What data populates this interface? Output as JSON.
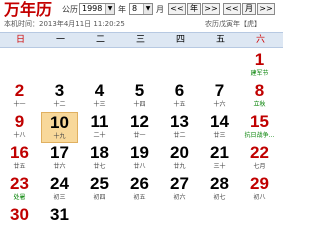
{
  "header": {
    "logo": "万年历",
    "gongli_label": "公历",
    "year_value": "1998",
    "year_unit": "年",
    "month_value": "8",
    "month_unit": "月",
    "buttons": [
      "<<",
      "年",
      ">>",
      "<<",
      "月",
      ">>"
    ]
  },
  "subheader": {
    "local_time": "本机时间：2013年4月11日 11:20:25",
    "nongli": "农历戊寅年【虎】"
  },
  "weekdays": [
    "日",
    "一",
    "二",
    "三",
    "四",
    "五",
    "六"
  ],
  "colors": {
    "weekend_red": "#c00000",
    "festival_green": "#008000",
    "today_highlight": "#f8d89a",
    "header_bg": "#dde7f3",
    "logo_red": "#c40000"
  },
  "calendar": {
    "today_day": "10",
    "rows": [
      [
        null,
        null,
        null,
        null,
        null,
        null,
        {
          "d": "1",
          "s": "建军节",
          "red": true,
          "green": true
        }
      ],
      [
        {
          "d": "2",
          "s": "十一",
          "red": true
        },
        {
          "d": "3",
          "s": "十二"
        },
        {
          "d": "4",
          "s": "十三"
        },
        {
          "d": "5",
          "s": "十四"
        },
        {
          "d": "6",
          "s": "十五"
        },
        {
          "d": "7",
          "s": "十六"
        },
        {
          "d": "8",
          "s": "立秋",
          "red": true,
          "green": true
        }
      ],
      [
        {
          "d": "9",
          "s": "十八",
          "red": true
        },
        {
          "d": "10",
          "s": "十九",
          "today": true
        },
        {
          "d": "11",
          "s": "二十"
        },
        {
          "d": "12",
          "s": "廿一"
        },
        {
          "d": "13",
          "s": "廿二"
        },
        {
          "d": "14",
          "s": "廿三"
        },
        {
          "d": "15",
          "s": "抗日战争…",
          "red": true,
          "green": true
        }
      ],
      [
        {
          "d": "16",
          "s": "廿五",
          "red": true
        },
        {
          "d": "17",
          "s": "廿六"
        },
        {
          "d": "18",
          "s": "廿七"
        },
        {
          "d": "19",
          "s": "廿八"
        },
        {
          "d": "20",
          "s": "廿九"
        },
        {
          "d": "21",
          "s": "三十"
        },
        {
          "d": "22",
          "s": "七月",
          "red": true
        }
      ],
      [
        {
          "d": "23",
          "s": "处暑",
          "red": true,
          "green": true
        },
        {
          "d": "24",
          "s": "初三"
        },
        {
          "d": "25",
          "s": "初四"
        },
        {
          "d": "26",
          "s": "初五"
        },
        {
          "d": "27",
          "s": "初六"
        },
        {
          "d": "28",
          "s": "初七"
        },
        {
          "d": "29",
          "s": "初八",
          "red": true
        }
      ],
      [
        {
          "d": "30",
          "s": "",
          "red": true
        },
        {
          "d": "31",
          "s": ""
        },
        null,
        null,
        null,
        null,
        null
      ]
    ]
  }
}
